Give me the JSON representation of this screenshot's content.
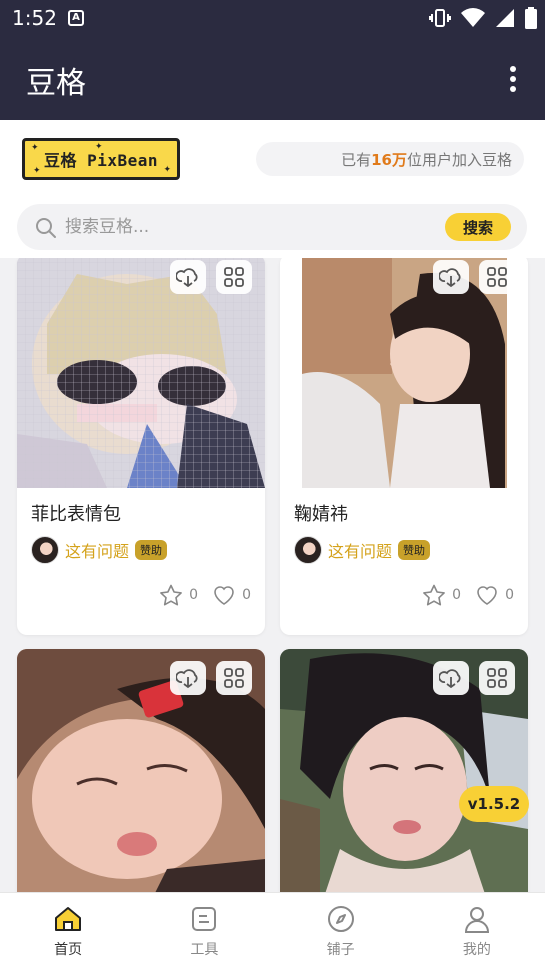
{
  "status": {
    "time": "1:52",
    "notif_badge": "A"
  },
  "appbar": {
    "title": "豆格"
  },
  "header": {
    "logo_text": "豆格 PixBean",
    "user_count_prefix": "已有",
    "user_count_num": "16万",
    "user_count_suffix": "位用户加入豆格"
  },
  "search": {
    "placeholder": "搜索豆格...",
    "button_label": "搜索"
  },
  "cards": [
    {
      "title": "菲比表情包",
      "author": "这有问题",
      "badge": "赞助",
      "stars": "0",
      "likes": "0"
    },
    {
      "title": "鞠婧祎",
      "author": "这有问题",
      "badge": "赞助",
      "stars": "0",
      "likes": "0"
    },
    {
      "title": "",
      "author": "",
      "badge": "",
      "stars": "",
      "likes": ""
    },
    {
      "title": "",
      "author": "",
      "badge": "",
      "stars": "",
      "likes": ""
    }
  ],
  "version": "v1.5.2",
  "nav": [
    {
      "label": "首页",
      "icon": "home-icon"
    },
    {
      "label": "工具",
      "icon": "tool-icon"
    },
    {
      "label": "铺子",
      "icon": "compass-icon"
    },
    {
      "label": "我的",
      "icon": "user-icon"
    }
  ],
  "colors": {
    "appbar": "#2b2b40",
    "accent": "#f8d035",
    "author": "#d4a21b",
    "count_highlight": "#e07a1a"
  }
}
